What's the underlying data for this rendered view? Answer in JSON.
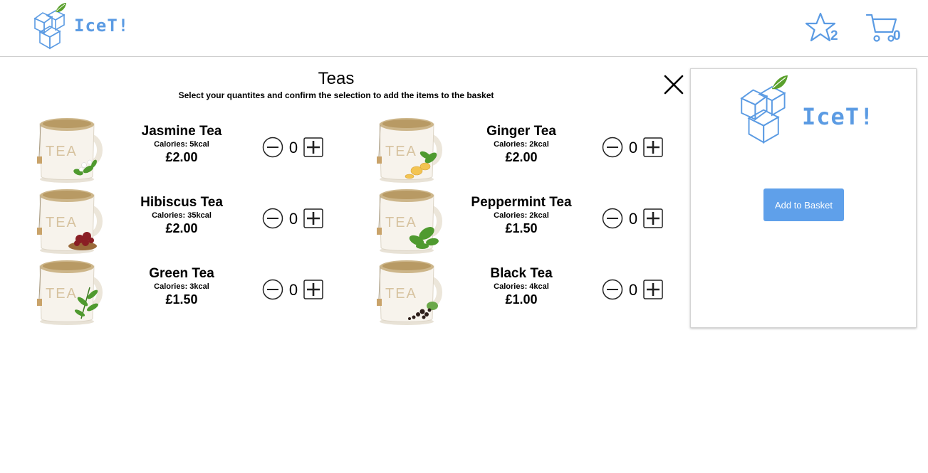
{
  "header": {
    "logo_text": "IceT!",
    "favourites_count": "2",
    "basket_count": "0"
  },
  "modal": {
    "title": "Teas",
    "subtitle": "Select your quantites and confirm the selection to add the items to the basket"
  },
  "products": [
    {
      "name": "Jasmine Tea",
      "calories": "Calories: 5kcal",
      "price": "£2.00",
      "quantity": "0"
    },
    {
      "name": "Ginger Tea",
      "calories": "Calories: 2kcal",
      "price": "£2.00",
      "quantity": "0"
    },
    {
      "name": "Hibiscus Tea",
      "calories": "Calories: 35kcal",
      "price": "£2.00",
      "quantity": "0"
    },
    {
      "name": "Peppermint Tea",
      "calories": "Calories: 2kcal",
      "price": "£1.50",
      "quantity": "0"
    },
    {
      "name": "Green Tea",
      "calories": "Calories: 3kcal",
      "price": "£1.50",
      "quantity": "0"
    },
    {
      "name": "Black Tea",
      "calories": "Calories: 4kcal",
      "price": "£1.00",
      "quantity": "0"
    }
  ],
  "mug_label": "TEA",
  "panel": {
    "logo_text": "IceT!",
    "add_button_label": "Add to Basket"
  },
  "colors": {
    "brand_blue": "#5b9be3",
    "button_blue": "#5fa0ea",
    "leaf_green": "#5aa02c"
  }
}
